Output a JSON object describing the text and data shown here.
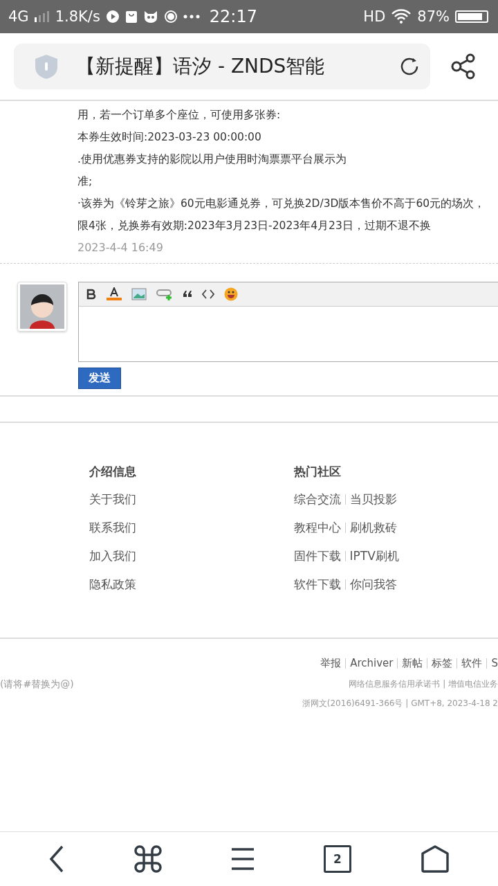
{
  "status_bar": {
    "network": "4G",
    "speed": "1.8K/s",
    "time": "22:17",
    "hd": "HD",
    "battery": "87%"
  },
  "address_bar": {
    "title": "【新提醒】语汐 - ZNDS智能"
  },
  "post": {
    "lines": [
      "用，若一个订单多个座位，可使用多张券:",
      "本券生效时间:2023-03-23 00:00:00",
      ".使用优惠券支持的影院以用户使用时淘票票平台展示为",
      "准;",
      "·该券为《铃芽之旅》60元电影通兑券，可兑换2D/3D版本售价不高于60元的场次，",
      "限4张，兑换券有效期:2023年3月23日-2023年4月23日，过期不退不换"
    ],
    "time": "2023-4-4 16:49"
  },
  "reply": {
    "send_button": "发送"
  },
  "footer": {
    "intro": {
      "title": "介绍信息",
      "links": [
        "关于我们",
        "联系我们",
        "加入我们",
        "隐私政策"
      ]
    },
    "hot": {
      "title": "热门社区",
      "rows": [
        [
          "综合交流",
          "当贝投影"
        ],
        [
          "教程中心",
          "刷机救砖"
        ],
        [
          "固件下载",
          "IPTV刷机"
        ],
        [
          "软件下载",
          "你问我答"
        ]
      ]
    },
    "contact_note": "(请将#替换为@)",
    "links": [
      "举报",
      "Archiver",
      "新帖",
      "标签",
      "软件",
      "S"
    ],
    "line_2": "网络信息服务信用承诺书 | 增值电信业务",
    "line_3": "浙网文(2016)6491-366号 | GMT+8, 2023-4-18 2"
  },
  "nav": {
    "tab_count": "2"
  }
}
